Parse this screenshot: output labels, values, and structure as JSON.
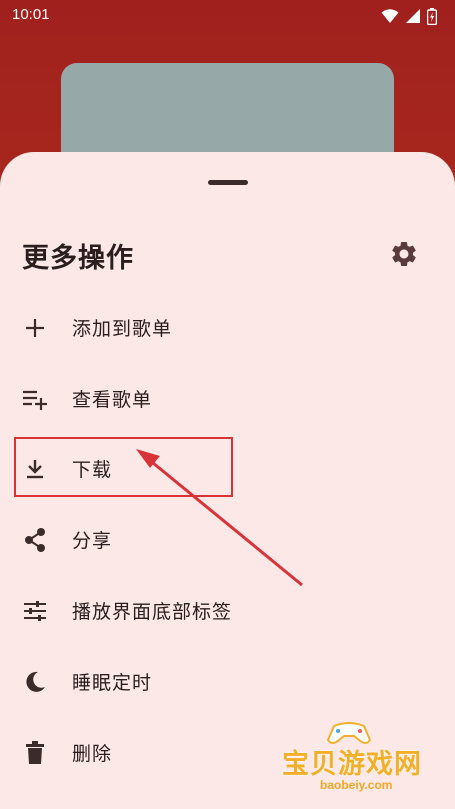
{
  "status_bar": {
    "time": "10:01"
  },
  "sheet": {
    "title": "更多操作",
    "items": [
      {
        "label": "添加到歌单",
        "icon": "plus-icon"
      },
      {
        "label": "查看歌单",
        "icon": "playlist-add-icon"
      },
      {
        "label": "下载",
        "icon": "download-icon"
      },
      {
        "label": "分享",
        "icon": "share-icon"
      },
      {
        "label": "播放界面底部标签",
        "icon": "tune-icon"
      },
      {
        "label": "睡眠定时",
        "icon": "moon-icon"
      },
      {
        "label": "删除",
        "icon": "trash-icon"
      }
    ]
  },
  "watermark": {
    "name": "宝贝游戏网",
    "url": "baobeiy.com"
  },
  "colors": {
    "sheet_bg": "#fce8e7",
    "accent": "#a0201e",
    "icon": "#3c2b2b",
    "annotation": "#d9333a"
  }
}
